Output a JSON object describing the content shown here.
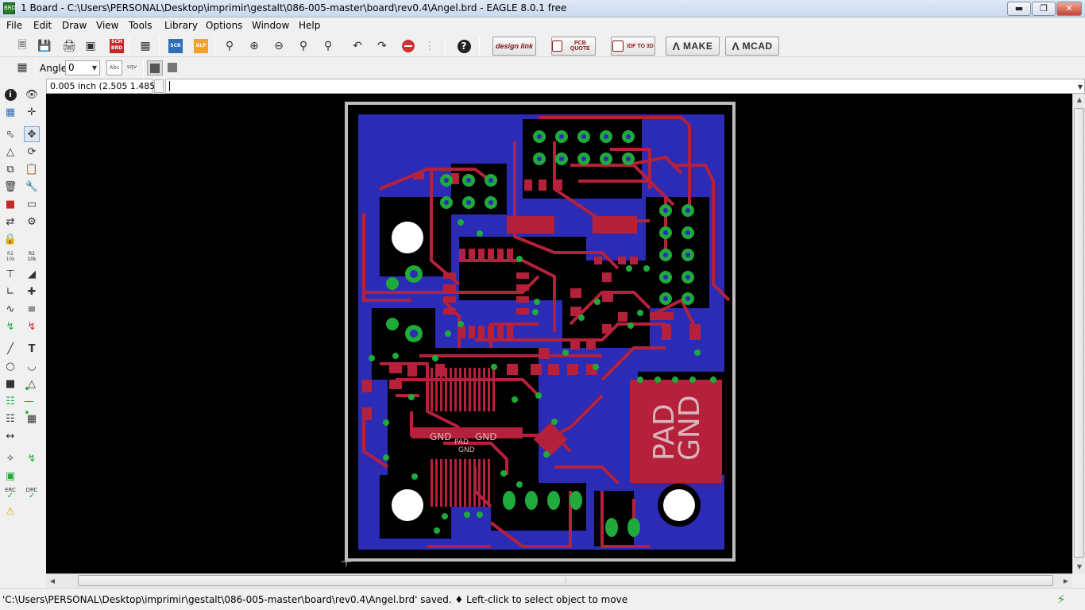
{
  "window": {
    "app_icon_label": "BRD",
    "title": "1 Board - C:\\Users\\PERSONAL\\Desktop\\imprimir\\gestalt\\086-005-master\\board\\rev0.4\\Angel.brd - EAGLE 8.0.1 free"
  },
  "menu": [
    "File",
    "Edit",
    "Draw",
    "View",
    "Tools",
    "Library",
    "Options",
    "Window",
    "Help"
  ],
  "toolbar": {
    "sch_brd": "SCH BRD",
    "scr": "SCR",
    "ulp": "ULP",
    "design_link": "design link",
    "pcb_quote": "PCB QUOTE",
    "idf_to_3d": "IDF TO 3D",
    "make": "MAKE",
    "mcad": "MCAD"
  },
  "toolbar2": {
    "angle_label": "Angle:",
    "angle_value": "0",
    "abc_label": "Abc",
    "sqv_label": "sqv"
  },
  "command": {
    "coordinates": "0.005 inch (2.505 1.485)",
    "input_value": ""
  },
  "board": {
    "labels": {
      "gnd_left": "GND",
      "gnd_right": "GND",
      "pad_small": "PAD",
      "gnd_small": "GND",
      "pad_big": "PAD",
      "gnd_big": "GND"
    },
    "colors": {
      "background": "#000000",
      "outline": "#bdbdbd",
      "bottom_copper": "#2b2bb5",
      "top_copper": "#b5213a",
      "via_pad": "#1faa3c"
    }
  },
  "palette": {
    "r2_label": "R2",
    "r2_value": "10k",
    "r2b_label": "R2",
    "r2b_value": "10k",
    "erc": "ERC",
    "drc": "DRC"
  },
  "status": {
    "message": "'C:\\Users\\PERSONAL\\Desktop\\imprimir\\gestalt\\086-005-master\\board\\rev0.4\\Angel.brd' saved.  ♦ Left-click to select object to move"
  }
}
